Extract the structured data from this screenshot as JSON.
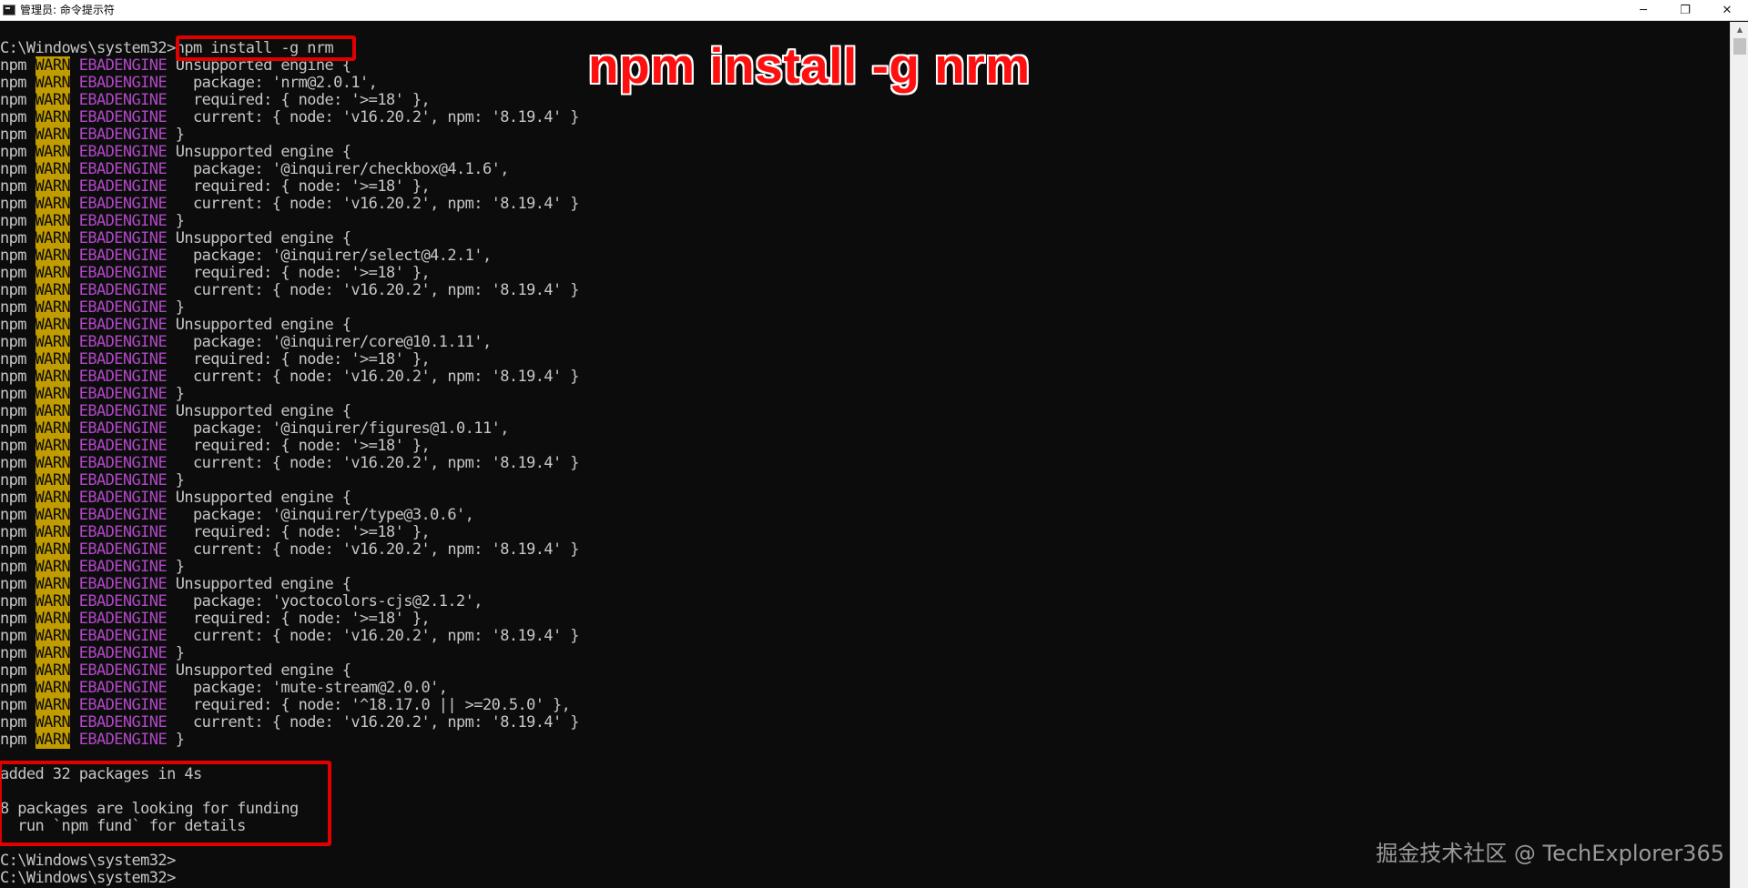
{
  "window": {
    "title": "管理员: 命令提示符",
    "controls": {
      "minimize": "─",
      "maximize": "❐",
      "close": "✕"
    }
  },
  "console": {
    "prompt_command": "C:\\Windows\\system32>npm install -g nrm",
    "warn_lines": [
      "Unsupported engine {",
      "  package: 'nrm@2.0.1',",
      "  required: { node: '>=18' },",
      "  current: { node: 'v16.20.2', npm: '8.19.4' }",
      "}",
      "Unsupported engine {",
      "  package: '@inquirer/checkbox@4.1.6',",
      "  required: { node: '>=18' },",
      "  current: { node: 'v16.20.2', npm: '8.19.4' }",
      "}",
      "Unsupported engine {",
      "  package: '@inquirer/select@4.2.1',",
      "  required: { node: '>=18' },",
      "  current: { node: 'v16.20.2', npm: '8.19.4' }",
      "}",
      "Unsupported engine {",
      "  package: '@inquirer/core@10.1.11',",
      "  required: { node: '>=18' },",
      "  current: { node: 'v16.20.2', npm: '8.19.4' }",
      "}",
      "Unsupported engine {",
      "  package: '@inquirer/figures@1.0.11',",
      "  required: { node: '>=18' },",
      "  current: { node: 'v16.20.2', npm: '8.19.4' }",
      "}",
      "Unsupported engine {",
      "  package: '@inquirer/type@3.0.6',",
      "  required: { node: '>=18' },",
      "  current: { node: 'v16.20.2', npm: '8.19.4' }",
      "}",
      "Unsupported engine {",
      "  package: 'yoctocolors-cjs@2.1.2',",
      "  required: { node: '>=18' },",
      "  current: { node: 'v16.20.2', npm: '8.19.4' }",
      "}",
      "Unsupported engine {",
      "  package: 'mute-stream@2.0.0',",
      "  required: { node: '^18.17.0 || >=20.5.0' },",
      "  current: { node: 'v16.20.2', npm: '8.19.4' }",
      "}"
    ],
    "warn_prefix": {
      "npm": "npm ",
      "warn": "WARN",
      "code": " EBADENGINE "
    },
    "summary": {
      "added": "added 32 packages in 4s",
      "funding": "8 packages are looking for funding",
      "fund_hint": "  run `npm fund` for details"
    },
    "final_prompts": [
      "C:\\Windows\\system32>",
      "C:\\Windows\\system32>"
    ]
  },
  "annotation": {
    "label": "npm install -g nrm",
    "color": "#ff1010"
  },
  "watermark": "掘金技术社区 @ TechExplorer365",
  "colors": {
    "background": "#0c0c0c",
    "text": "#c6c6c6",
    "warn_bg": "#c19c00",
    "code": "#b148c6",
    "highlight_box": "#e00000"
  }
}
